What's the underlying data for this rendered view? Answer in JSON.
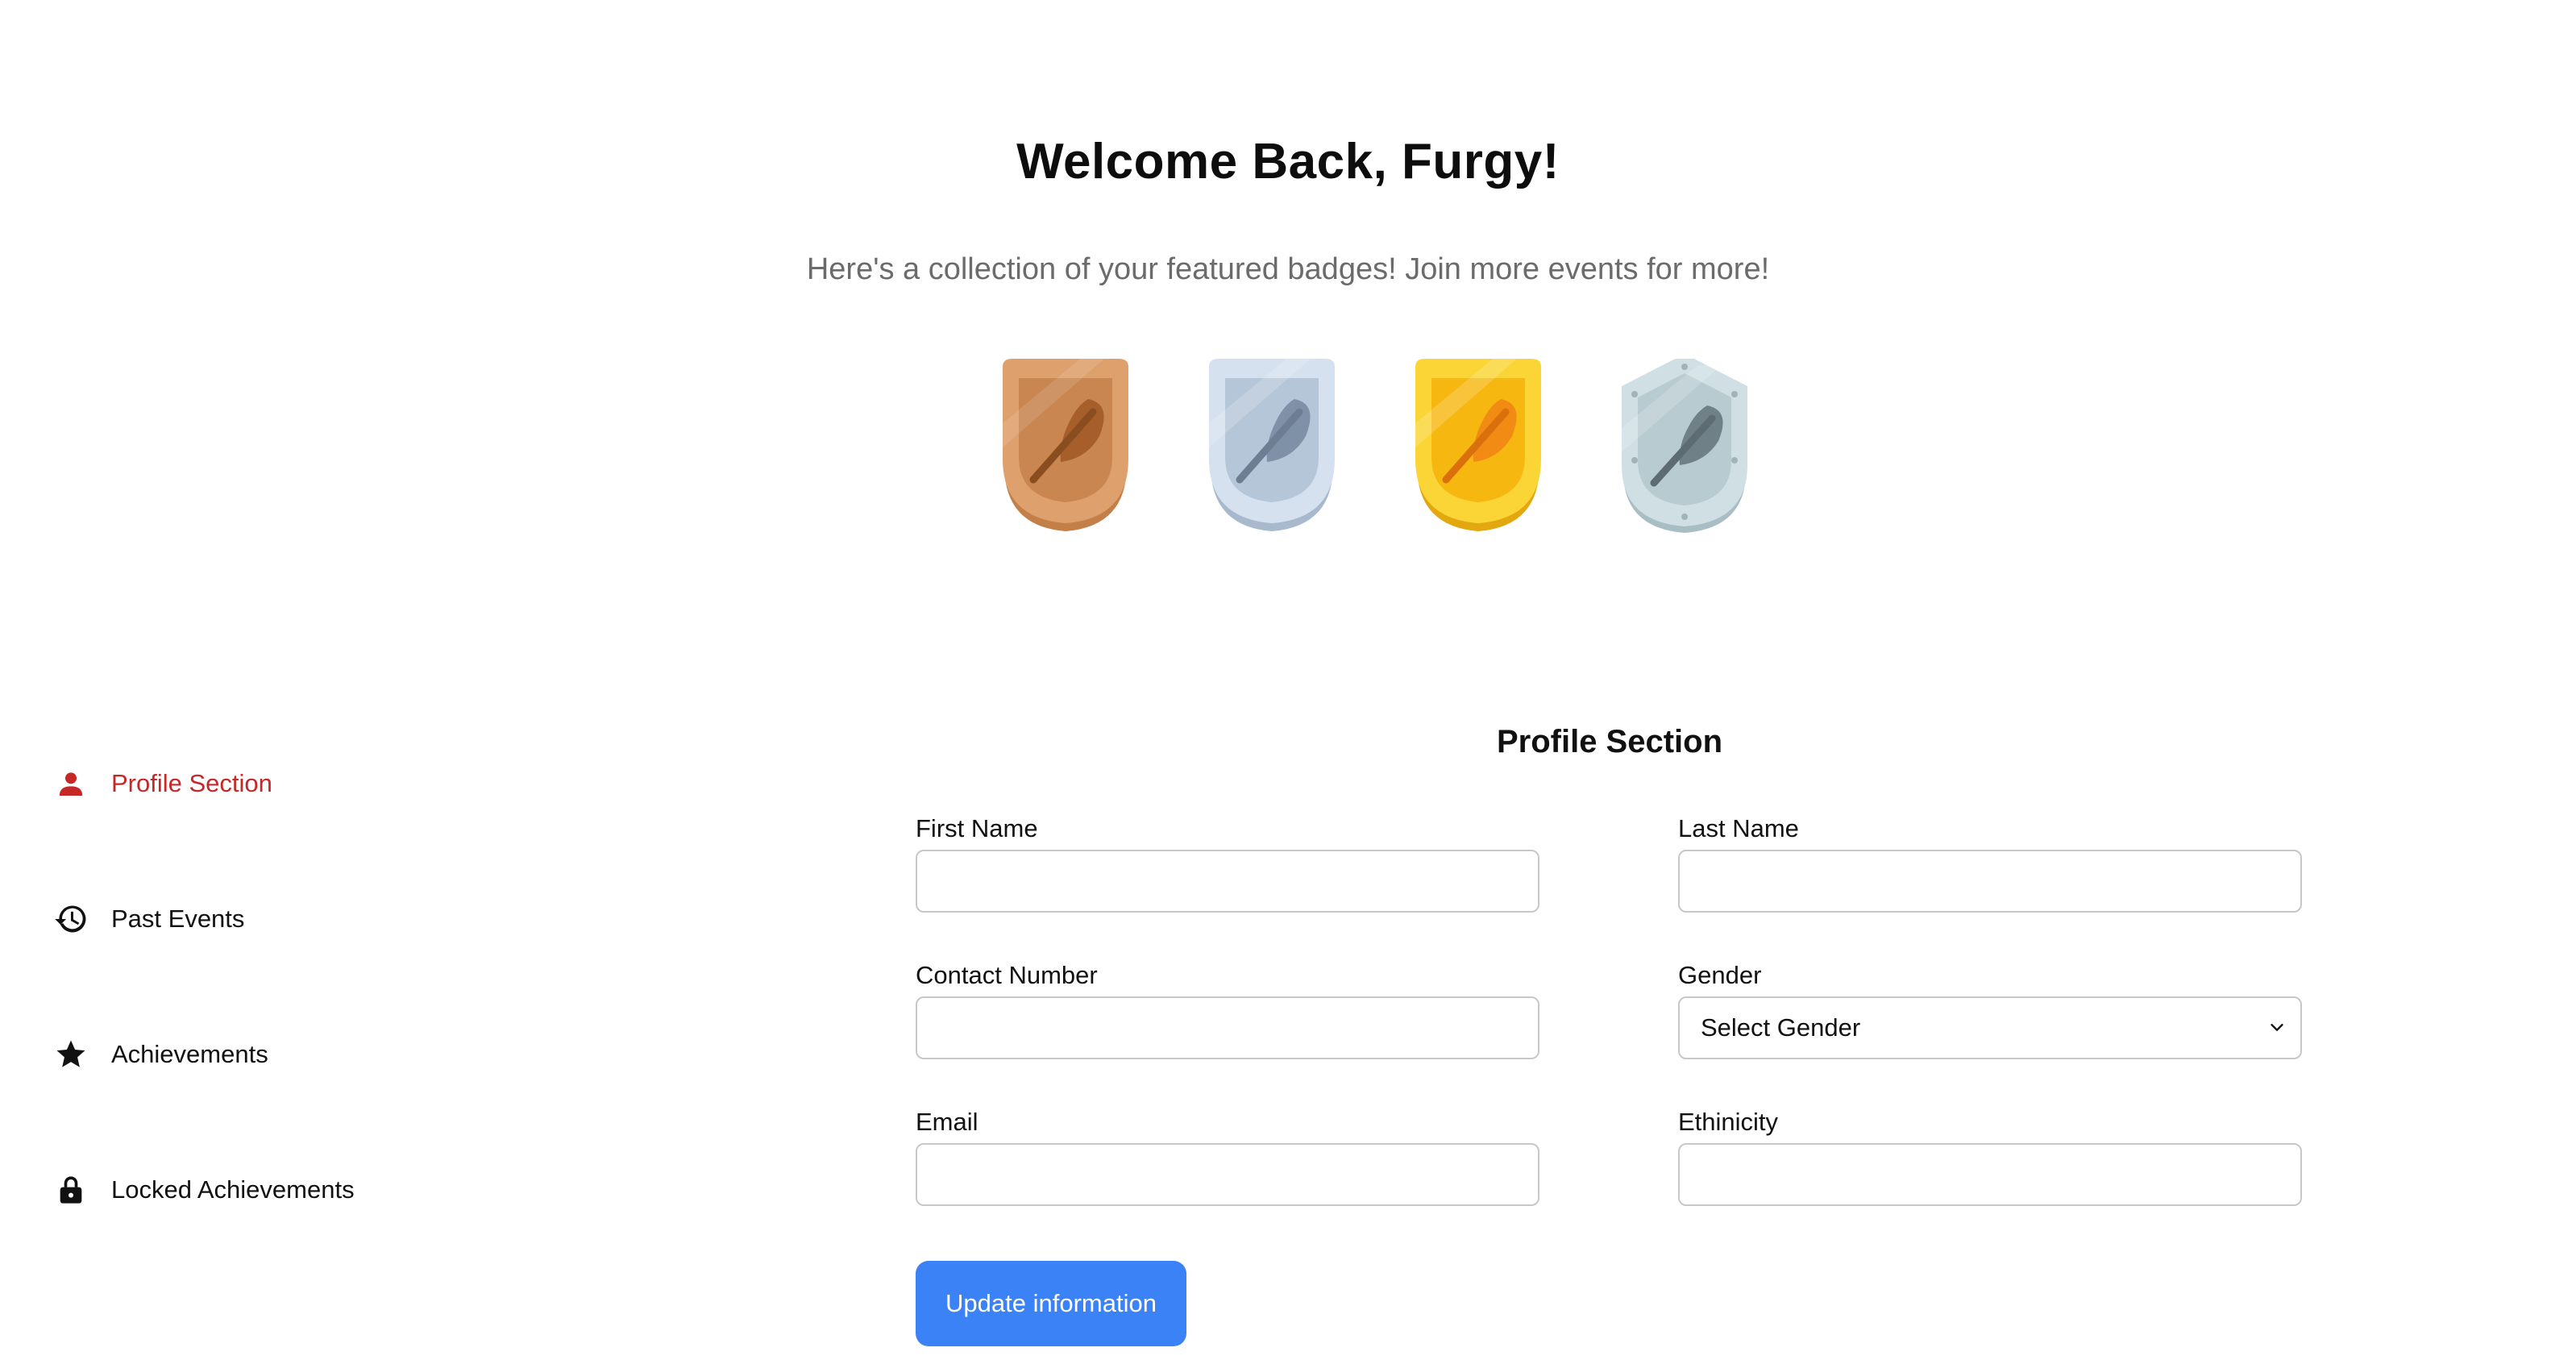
{
  "header": {
    "title": "Welcome Back, Furgy!",
    "subtitle": "Here's a collection of your featured badges! Join more events for more!"
  },
  "badges": [
    {
      "name": "bronze-feather-badge",
      "color": "#d9965f"
    },
    {
      "name": "silver-feather-badge",
      "color": "#c9d7e6"
    },
    {
      "name": "gold-feather-badge",
      "color": "#f7c21d"
    },
    {
      "name": "platinum-feather-badge",
      "color": "#c4d6dc"
    }
  ],
  "sidebar": {
    "items": [
      {
        "label": "Profile Section",
        "icon": "person-icon",
        "active": true
      },
      {
        "label": "Past Events",
        "icon": "history-icon",
        "active": false
      },
      {
        "label": "Achievements",
        "icon": "star-icon",
        "active": false
      },
      {
        "label": "Locked Achievements",
        "icon": "lock-icon",
        "active": false
      }
    ]
  },
  "profile": {
    "title": "Profile Section",
    "fields": {
      "first_name": {
        "label": "First Name",
        "value": ""
      },
      "last_name": {
        "label": "Last Name",
        "value": ""
      },
      "contact_number": {
        "label": "Contact Number",
        "value": ""
      },
      "gender": {
        "label": "Gender",
        "selected": "Select Gender"
      },
      "email": {
        "label": "Email",
        "value": ""
      },
      "ethnicity": {
        "label": "Ethinicity",
        "value": ""
      }
    },
    "submit_label": "Update information"
  },
  "colors": {
    "accent_active": "#c62828",
    "button": "#3b82f6",
    "subtitle": "#6b6b6b"
  }
}
